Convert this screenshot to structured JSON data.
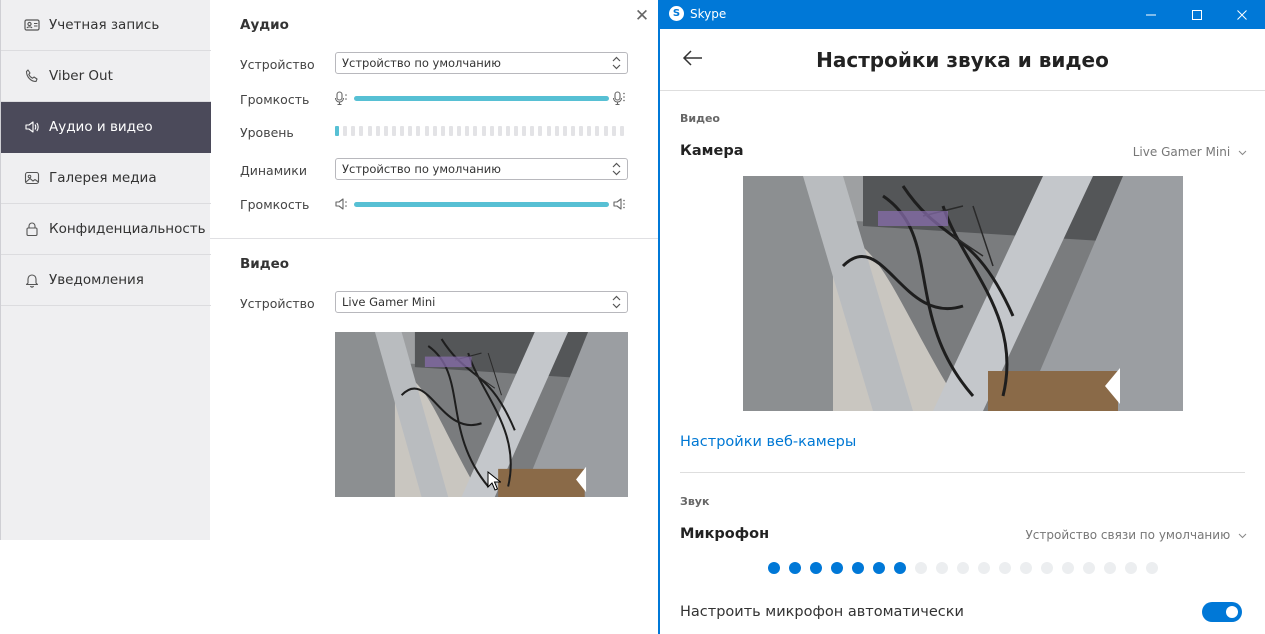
{
  "viber": {
    "sidebar": {
      "items": [
        {
          "label": "Учетная запись",
          "icon": "id-card-icon",
          "active": false
        },
        {
          "label": "Viber Out",
          "icon": "phone-icon",
          "active": false
        },
        {
          "label": "Аудио и видео",
          "icon": "speaker-icon",
          "active": true
        },
        {
          "label": "Галерея медиа",
          "icon": "image-icon",
          "active": false
        },
        {
          "label": "Конфиденциальность",
          "icon": "lock-icon",
          "active": false
        },
        {
          "label": "Уведомления",
          "icon": "bell-icon",
          "active": false
        }
      ]
    },
    "audio": {
      "title": "Аудио",
      "device_label": "Устройство",
      "device_value": "Устройство по умолчанию",
      "volume_label": "Громкость",
      "level_label": "Уровень",
      "level_fraction": 0.03,
      "speakers_label": "Динамики",
      "speakers_value": "Устройство по умолчанию",
      "speakers_volume_label": "Громкость"
    },
    "video": {
      "title": "Видео",
      "device_label": "Устройство",
      "device_value": "Live Gamer Mini"
    },
    "accent_color": "#57c0d4",
    "active_item_color": "#4b4a5a"
  },
  "skype": {
    "window_title": "Skype",
    "heading": "Настройки звука и видео",
    "video_section": "Видео",
    "camera_label": "Камера",
    "camera_value": "Live Gamer Mini",
    "webcam_settings_link": "Настройки веб-камеры",
    "sound_section": "Звук",
    "mic_label": "Микрофон",
    "mic_value": "Устройство связи по умолчанию",
    "mic_level_dots_total": 19,
    "mic_level_dots_on": 7,
    "auto_mic_label": "Настроить микрофон автоматически",
    "auto_mic_enabled": true,
    "accent_color": "#0078d7"
  }
}
